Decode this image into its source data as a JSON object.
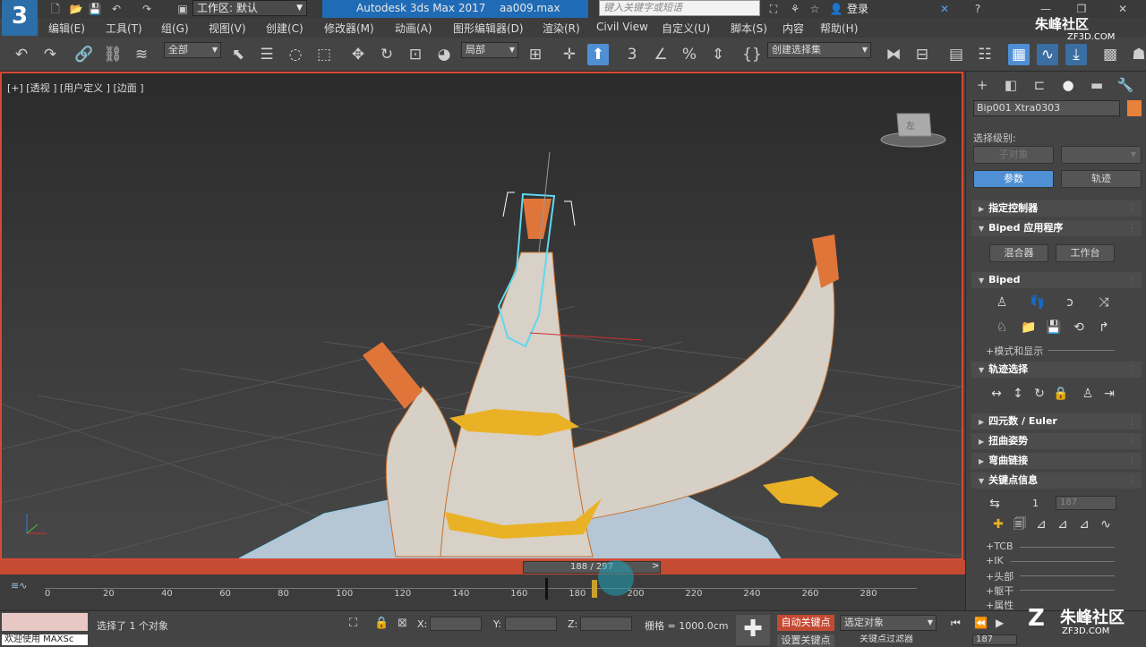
{
  "titlebar": {
    "logo": "3",
    "logo_sub": "MAX",
    "workspace": "工作区: 默认",
    "app_title": "Autodesk 3ds Max 2017",
    "file_name": "aa009.max",
    "search_placeholder": "键入关键字或短语",
    "login": "登录"
  },
  "menu": [
    "编辑(E)",
    "工具(T)",
    "组(G)",
    "视图(V)",
    "创建(C)",
    "修改器(M)",
    "动画(A)",
    "图形编辑器(D)",
    "渲染(R)",
    "Civil View",
    "自定义(U)",
    "脚本(S)",
    "内容",
    "帮助(H)"
  ],
  "toolbar": {
    "filter": "全部",
    "coord": "局部",
    "selection_set": "创建选择集"
  },
  "viewport": {
    "label": "[+] [透视 ] [用户定义 ] [边面 ]",
    "viewcube_label": "左"
  },
  "panel": {
    "object_name": "Bip001 Xtra0303",
    "object_color": "#e8813b",
    "select_level_label": "选择级别:",
    "sub_object_btn": "子对象",
    "params_btn": "参数",
    "track_btn": "轨迹",
    "rollouts": {
      "assign_controller": "指定控制器",
      "biped_apps": "Biped 应用程序",
      "mixer_btn": "混合器",
      "workbench_btn": "工作台",
      "biped": "Biped",
      "modes_display": "+模式和显示",
      "track_selection": "轨迹选择",
      "quaternion": "四元数 / Euler",
      "twist_poses": "扭曲姿势",
      "bend_links": "弯曲链接",
      "key_info": "关键点信息",
      "key_number": "1",
      "key_frame": "187",
      "tcb": "+TCB",
      "ik": "+IK",
      "head": "+头部",
      "body": "+躯干",
      "props": "+属性"
    }
  },
  "timeline": {
    "slider_text": "188 / 297",
    "ticks": [
      "0",
      "20",
      "40",
      "60",
      "80",
      "100",
      "120",
      "140",
      "160",
      "180",
      "200",
      "220",
      "240",
      "260",
      "280"
    ],
    "current_frame": 188,
    "total_frames": 297
  },
  "status": {
    "selected": "选择了 1 个对象",
    "welcome": "欢迎使用 MAXSc",
    "x_label": "X:",
    "y_label": "Y:",
    "z_label": "Z:",
    "grid": "栅格 = 1000.0cm",
    "auto_key": "自动关键点",
    "set_key": "设置关键点",
    "selected_obj": "选定对象",
    "key_filters": "关键点过滤器",
    "frame": "187"
  },
  "watermark": {
    "top": "朱峰社区",
    "top_sub": "ZF3D.COM",
    "bottom": "朱峰社区",
    "bottom_sub": "ZF3D.COM"
  },
  "colors": {
    "accent": "#4f8fd4",
    "viewport_border": "#d64a35",
    "bone_orange": "#e0753a",
    "selection_cyan": "#5fd8f0"
  }
}
